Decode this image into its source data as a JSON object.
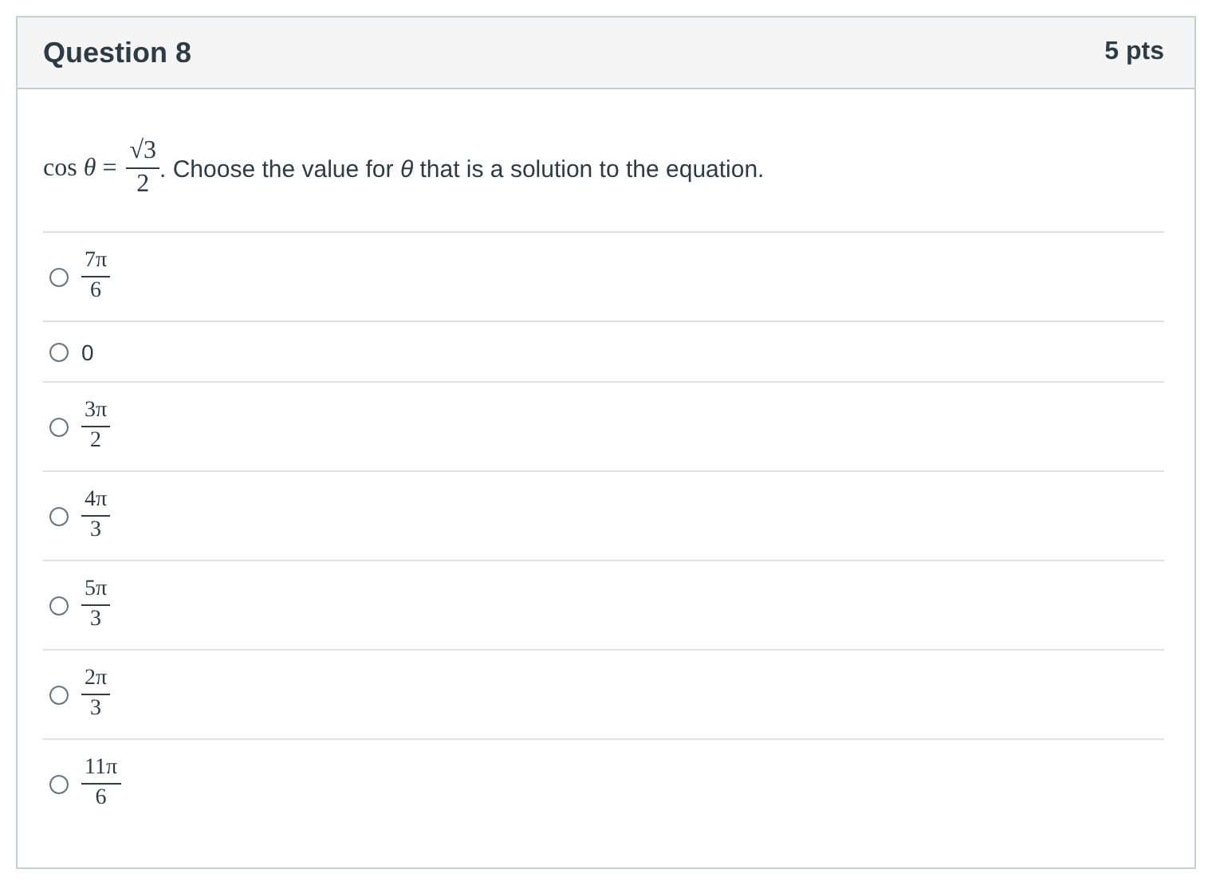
{
  "question": {
    "title": "Question 8",
    "points": "5 pts",
    "stem": {
      "lhs": "cos *θ* =",
      "numerator": "√3",
      "denominator": "2",
      "text": ". Choose the value for *θ* that is a solution to the equation."
    },
    "answers": [
      {
        "kind": "fraction",
        "numerator": "7π",
        "denominator": "6",
        "selected": false
      },
      {
        "kind": "plain",
        "text": "0",
        "selected": false
      },
      {
        "kind": "fraction",
        "numerator": "3π",
        "denominator": "2",
        "selected": false
      },
      {
        "kind": "fraction",
        "numerator": "4π",
        "denominator": "3",
        "selected": false
      },
      {
        "kind": "fraction",
        "numerator": "5π",
        "denominator": "3",
        "selected": false
      },
      {
        "kind": "fraction",
        "numerator": "2π",
        "denominator": "3",
        "selected": false
      },
      {
        "kind": "fraction",
        "numerator": "11π",
        "denominator": "6",
        "selected": false
      }
    ]
  }
}
